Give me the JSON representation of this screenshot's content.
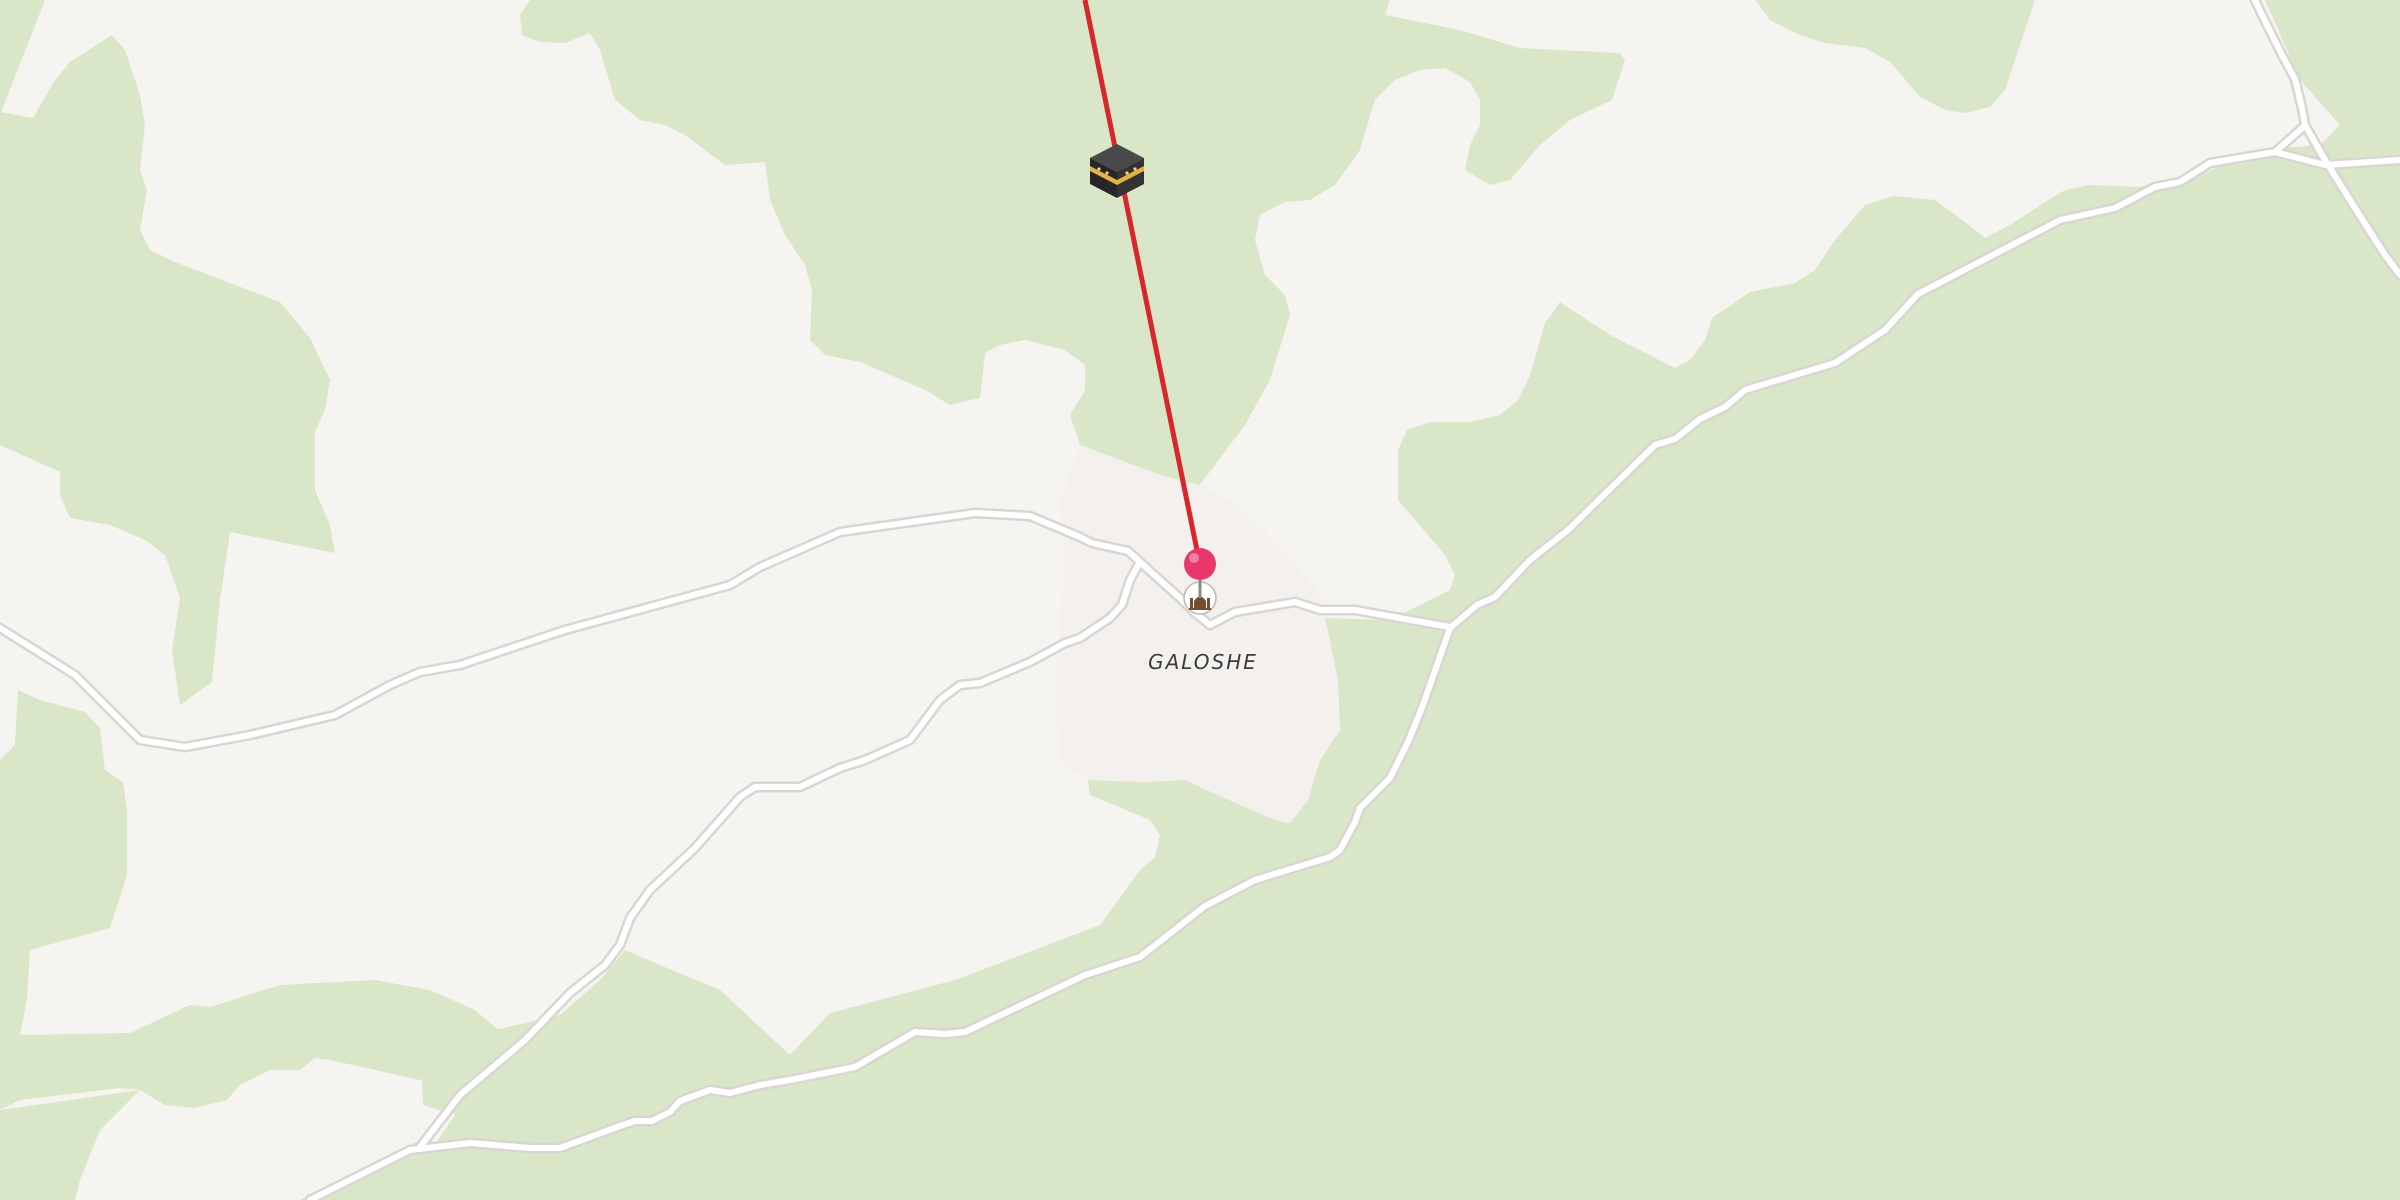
{
  "map": {
    "place_label": "GALOSHE",
    "colors": {
      "land": "#f6f4f1",
      "forest": "#d9e7c8",
      "settlement": "#f2efed",
      "road_casing": "#d8d6d3",
      "road_fill": "#ffffff",
      "qibla_line": "#d9262b",
      "pin": "#e8386b"
    },
    "markers": {
      "direction_marker_icon": "kaaba-icon",
      "location_pin_icon": "map-pin-icon",
      "place_icon": "mosque-icon"
    }
  }
}
